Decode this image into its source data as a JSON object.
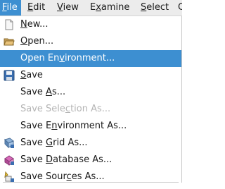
{
  "menubar": {
    "items": [
      {
        "label": "File",
        "mnemonic": "F",
        "rest": "ile",
        "active": true
      },
      {
        "label": "Edit",
        "mnemonic": "E",
        "rest": "dit"
      },
      {
        "label": "View",
        "mnemonic": "V",
        "rest": "iew"
      },
      {
        "label": "Examine",
        "pre": "E",
        "mnemonic": "x",
        "rest": "amine"
      },
      {
        "label": "Select",
        "mnemonic": "S",
        "rest": "elect"
      },
      {
        "label": "C",
        "pre": "C",
        "mnemonic": "",
        "rest": ""
      }
    ]
  },
  "file_menu": {
    "items": [
      {
        "label": "New...",
        "pre": "",
        "mnemonic": "N",
        "rest": "ew...",
        "icon": "new-document-icon",
        "state": "normal"
      },
      {
        "label": "Open...",
        "pre": "",
        "mnemonic": "O",
        "rest": "pen...",
        "icon": "folder-open-icon",
        "state": "normal"
      },
      {
        "label": "Open Environment...",
        "pre": "Open En",
        "mnemonic": "v",
        "rest": "ironment...",
        "icon": "",
        "state": "highlighted"
      },
      {
        "label": "Save",
        "pre": "",
        "mnemonic": "S",
        "rest": "ave",
        "icon": "save-floppy-icon",
        "state": "normal"
      },
      {
        "label": "Save As...",
        "pre": "Save ",
        "mnemonic": "A",
        "rest": "s...",
        "icon": "",
        "state": "normal"
      },
      {
        "label": "Save Selection As...",
        "pre": "Save Sele",
        "mnemonic": "c",
        "rest": "tion As...",
        "icon": "",
        "state": "disabled"
      },
      {
        "label": "Save Environment As...",
        "pre": "Save E",
        "mnemonic": "n",
        "rest": "vironment As...",
        "icon": "",
        "state": "normal"
      },
      {
        "label": "Save Grid As...",
        "pre": "Save ",
        "mnemonic": "G",
        "rest": "rid As...",
        "icon": "save-grid-icon",
        "state": "normal"
      },
      {
        "label": "Save Database As...",
        "pre": "Save ",
        "mnemonic": "D",
        "rest": "atabase As...",
        "icon": "save-database-icon",
        "state": "normal"
      },
      {
        "label": "Save Sources As...",
        "pre": "Save Sour",
        "mnemonic": "c",
        "rest": "es As...",
        "icon": "save-sources-icon",
        "state": "normal"
      }
    ]
  },
  "colors": {
    "highlight": "#3d8fd1",
    "disabled_text": "#b4b4b4",
    "menubar_bg": "#ececec"
  }
}
